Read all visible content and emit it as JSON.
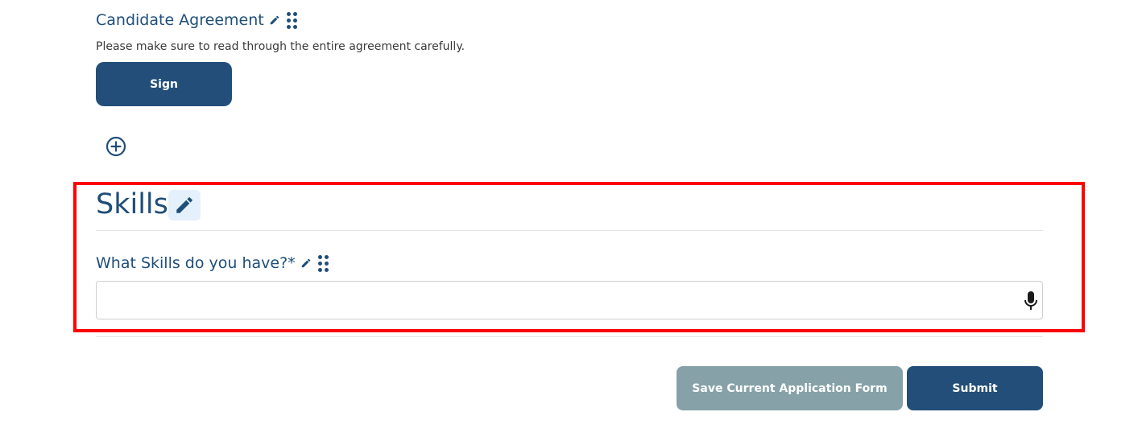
{
  "candidate_agreement": {
    "title": "Candidate Agreement",
    "help_text": "Please make sure to read through the entire agreement carefully.",
    "sign_label": "Sign"
  },
  "skills_section": {
    "title": "Skills",
    "question_label": "What Skills do you have?*",
    "answer_value": ""
  },
  "footer": {
    "save_label": "Save Current Application Form",
    "submit_label": "Submit"
  },
  "icons": {
    "edit": "pencil-icon",
    "reorder": "drag-handle-icon",
    "add": "plus-circle-icon",
    "voice": "microphone-icon"
  },
  "colors": {
    "primary": "#224e79",
    "secondary": "#86a2a8",
    "highlight": "#ff0000",
    "edit_bg": "#e4f0fb"
  }
}
